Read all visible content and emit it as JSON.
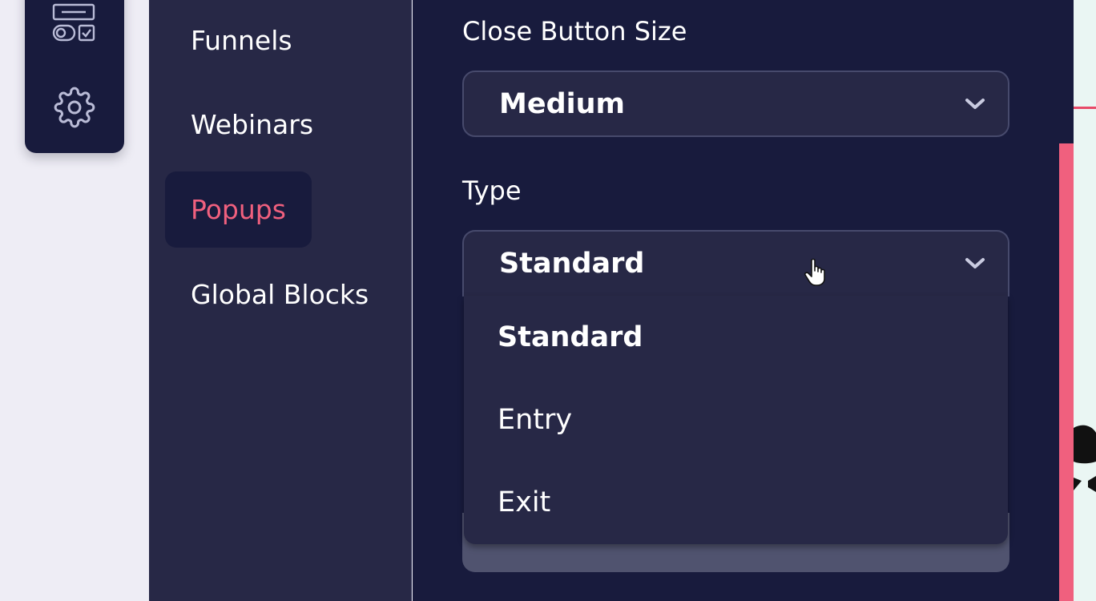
{
  "icon_rail": {
    "icons": [
      "form-layout-icon",
      "gear-icon"
    ]
  },
  "nav": {
    "items": [
      {
        "label": "Funnels"
      },
      {
        "label": "Webinars"
      },
      {
        "label": "Popups",
        "active": true
      },
      {
        "label": "Global Blocks"
      }
    ]
  },
  "settings": {
    "close_button_size": {
      "label": "Close Button Size",
      "value": "Medium"
    },
    "type": {
      "label": "Type",
      "value": "Standard",
      "options": [
        "Standard",
        "Entry",
        "Exit"
      ],
      "selected": "Standard"
    }
  },
  "colors": {
    "accent": "#f0607e",
    "panel_dark": "#181b3d",
    "panel_mid": "#272846"
  }
}
